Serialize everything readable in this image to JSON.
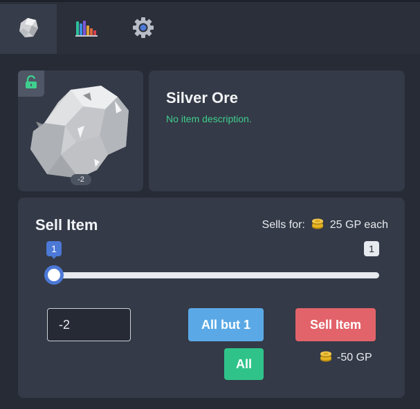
{
  "tabs": [
    {
      "icon": "ore-icon",
      "active": true
    },
    {
      "icon": "bar-chart-icon",
      "active": false
    },
    {
      "icon": "gear-icon",
      "active": false
    }
  ],
  "item": {
    "name": "Silver Ore",
    "description": "No item description.",
    "quantity_badge": "-2",
    "lock_icon": "unlock-icon"
  },
  "sell": {
    "title": "Sell Item",
    "sells_for_label": "Sells for:",
    "price_text": "25 GP each",
    "slider": {
      "value": "1",
      "max": "1"
    },
    "quantity_input": "-2",
    "all_but_one_label": "All but 1",
    "sell_button_label": "Sell Item",
    "all_label": "All",
    "total_text": "-50 GP"
  },
  "colors": {
    "accent_blue": "#4c78d6",
    "button_blue": "#5aa9e6",
    "button_red": "#e2636a",
    "button_green": "#2fc38a",
    "description_green": "#3fcf8e"
  }
}
